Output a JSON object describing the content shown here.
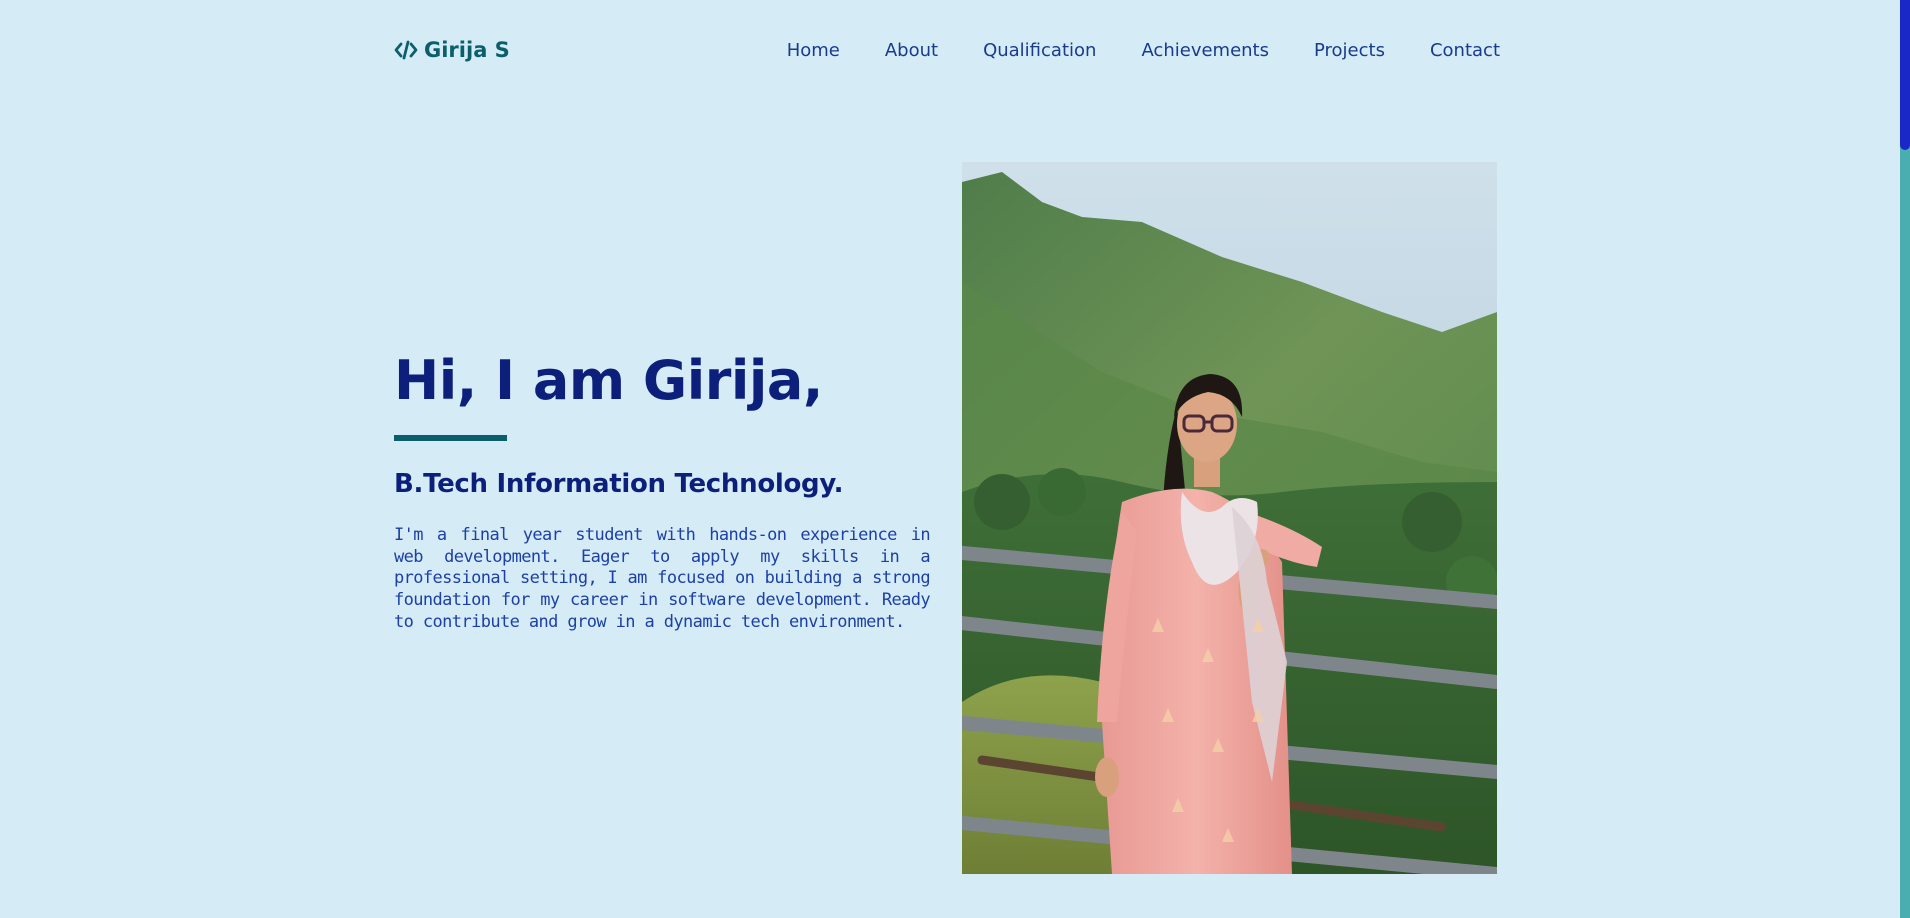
{
  "header": {
    "logo_icon": "code-icon",
    "logo_text": "Girija S",
    "nav": [
      {
        "label": "Home"
      },
      {
        "label": "About"
      },
      {
        "label": "Qualification"
      },
      {
        "label": "Achievements"
      },
      {
        "label": "Projects"
      },
      {
        "label": "Contact"
      }
    ]
  },
  "hero": {
    "greeting": "Hi, I am Girija,",
    "degree": "B.Tech Information Technology.",
    "bio": "I'm a final year student with hands-on experience in web development. Eager to apply my skills in a professional setting, I am focused on building a strong foundation for my career in software development. Ready to contribute and grow in a dynamic tech environment.",
    "photo_icon": "profile-photo"
  },
  "colors": {
    "background": "#d5ecf6",
    "logo": "#0b5f6b",
    "nav_text": "#1a3a8f",
    "heading": "#0c1f7a",
    "body_text": "#1c3fa8",
    "accent_underline": "#0b5f6b",
    "scrollbar_track": "#4aaeb0",
    "scrollbar_thumb": "#1a28c8"
  }
}
